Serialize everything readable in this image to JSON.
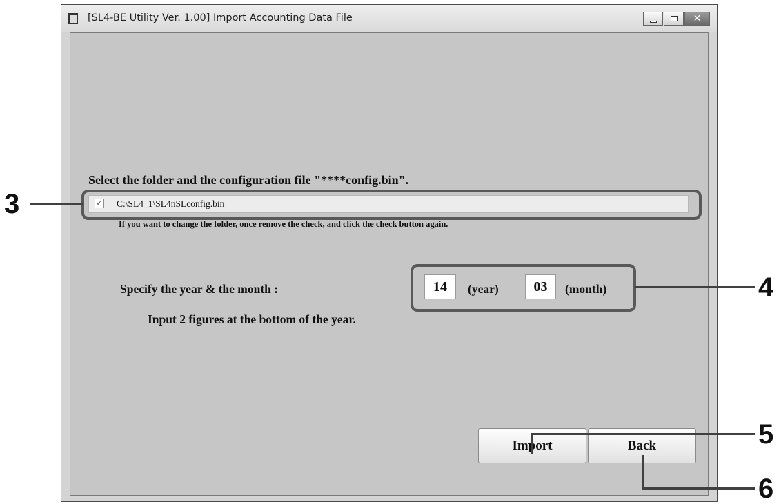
{
  "window": {
    "title": "[SL4-BE Utility Ver. 1.00]   Import Accounting Data File",
    "minimize_glyph": "",
    "close_glyph": "✕"
  },
  "file_section": {
    "label": "Select the folder and the configuration file \"****config.bin\".",
    "checkbox_checked": true,
    "checkbox_glyph": "✓",
    "path": "C:\\SL4_1\\SL4nSLconfig.bin",
    "help": "If you want to change the folder, once remove the check, and click the check button again."
  },
  "date_section": {
    "label": "Specify the year & the month :",
    "note": "Input 2 figures at the bottom of the year.",
    "year_value": "14",
    "year_unit": "(year)",
    "month_value": "03",
    "month_unit": "(month)"
  },
  "buttons": {
    "import_label": "Import",
    "back_label": "Back"
  },
  "callouts": {
    "c3": "3",
    "c4": "4",
    "c5": "5",
    "c6": "6"
  }
}
